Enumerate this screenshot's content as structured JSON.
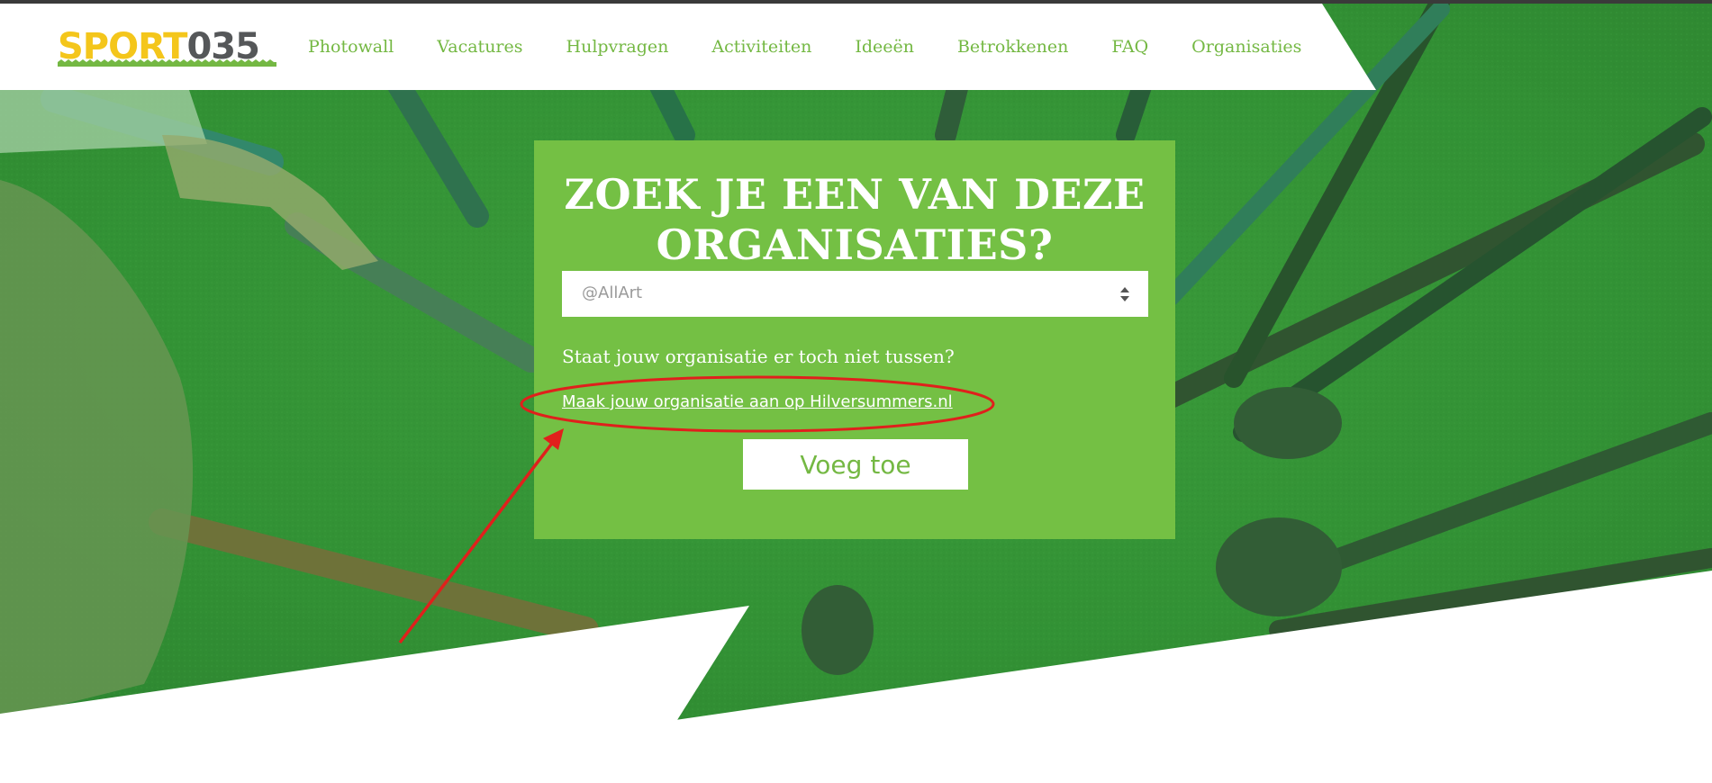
{
  "logo": {
    "part1": "SP",
    "ball": "O",
    "part2": "RT",
    "number": "035"
  },
  "nav": {
    "items": [
      {
        "label": "Photowall"
      },
      {
        "label": "Vacatures"
      },
      {
        "label": "Hulpvragen"
      },
      {
        "label": "Activiteiten"
      },
      {
        "label": "Ideeën"
      },
      {
        "label": "Betrokkenen"
      },
      {
        "label": "FAQ"
      },
      {
        "label": "Organisaties"
      }
    ]
  },
  "search": {
    "title_line1": "ZOEK JE EEN VAN DEZE",
    "title_line2": "ORGANISATIES?",
    "selected": "@AllArt",
    "question": "Staat jouw organisatie er toch niet tussen?",
    "link_text": "Maak jouw organisatie aan op Hilversummers.nl",
    "button_label": "Voeg toe"
  },
  "colors": {
    "brand_green": "#74c044",
    "nav_text": "#74b843",
    "logo_yellow": "#f4c61b",
    "logo_grey": "#555759",
    "annotation_red": "#e0201c"
  }
}
